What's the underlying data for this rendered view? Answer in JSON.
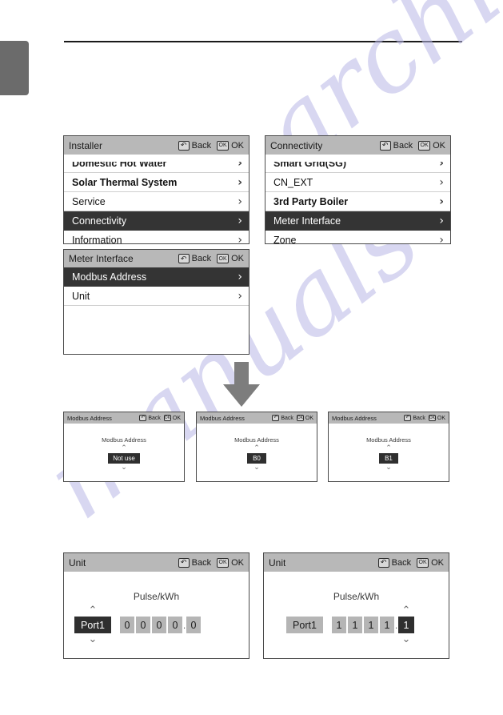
{
  "icons": {
    "back_glyph": "↶",
    "ok_glyph": "OK",
    "chevron_right": "›",
    "chevron_up": "⌃",
    "chevron_down": "⌄",
    "down_arrow": "down-arrow"
  },
  "header_actions": {
    "back_label": "Back",
    "ok_label": "OK"
  },
  "watermark": {
    "line1": "archive.com",
    "line2": "manuals"
  },
  "panels": {
    "installer": {
      "title": "Installer",
      "rows": [
        {
          "label": "Domestic Hot Water",
          "selected": false,
          "clipped": true
        },
        {
          "label": "Solar Thermal System",
          "selected": false,
          "clipped": false
        },
        {
          "label": "Service",
          "selected": false,
          "clipped": false
        },
        {
          "label": "Connectivity",
          "selected": true,
          "clipped": false
        },
        {
          "label": "Information",
          "selected": false,
          "clipped": false
        }
      ]
    },
    "connectivity": {
      "title": "Connectivity",
      "rows": [
        {
          "label": "Smart Grid(SG)",
          "selected": false,
          "clipped": true
        },
        {
          "label": "CN_EXT",
          "selected": false,
          "clipped": false
        },
        {
          "label": "3rd Party Boiler",
          "selected": false,
          "clipped": false
        },
        {
          "label": "Meter Interface",
          "selected": true,
          "clipped": false
        },
        {
          "label": "Zone",
          "selected": false,
          "clipped": false
        }
      ]
    },
    "meter_interface": {
      "title": "Meter Interface",
      "rows": [
        {
          "label": "Modbus Address",
          "selected": true,
          "clipped": false
        },
        {
          "label": "Unit",
          "selected": false,
          "clipped": false
        }
      ]
    },
    "modbus_1": {
      "title": "Modbus Address",
      "caption": "Modbus Address",
      "value": "Not use"
    },
    "modbus_2": {
      "title": "Modbus Address",
      "caption": "Modbus Address",
      "value": "B0"
    },
    "modbus_3": {
      "title": "Modbus Address",
      "caption": "Modbus Address",
      "value": "B1"
    },
    "unit_1": {
      "title": "Unit",
      "caption": "Pulse/kWh",
      "port_label": "Port1",
      "port_selected": true,
      "digits": [
        "0",
        "0",
        "0",
        "0",
        "0"
      ],
      "decimal_before_index": 4,
      "selected_digit_index": -1
    },
    "unit_2": {
      "title": "Unit",
      "caption": "Pulse/kWh",
      "port_label": "Port1",
      "port_selected": false,
      "digits": [
        "1",
        "1",
        "1",
        "1",
        "1"
      ],
      "decimal_before_index": 4,
      "selected_digit_index": 4
    }
  }
}
